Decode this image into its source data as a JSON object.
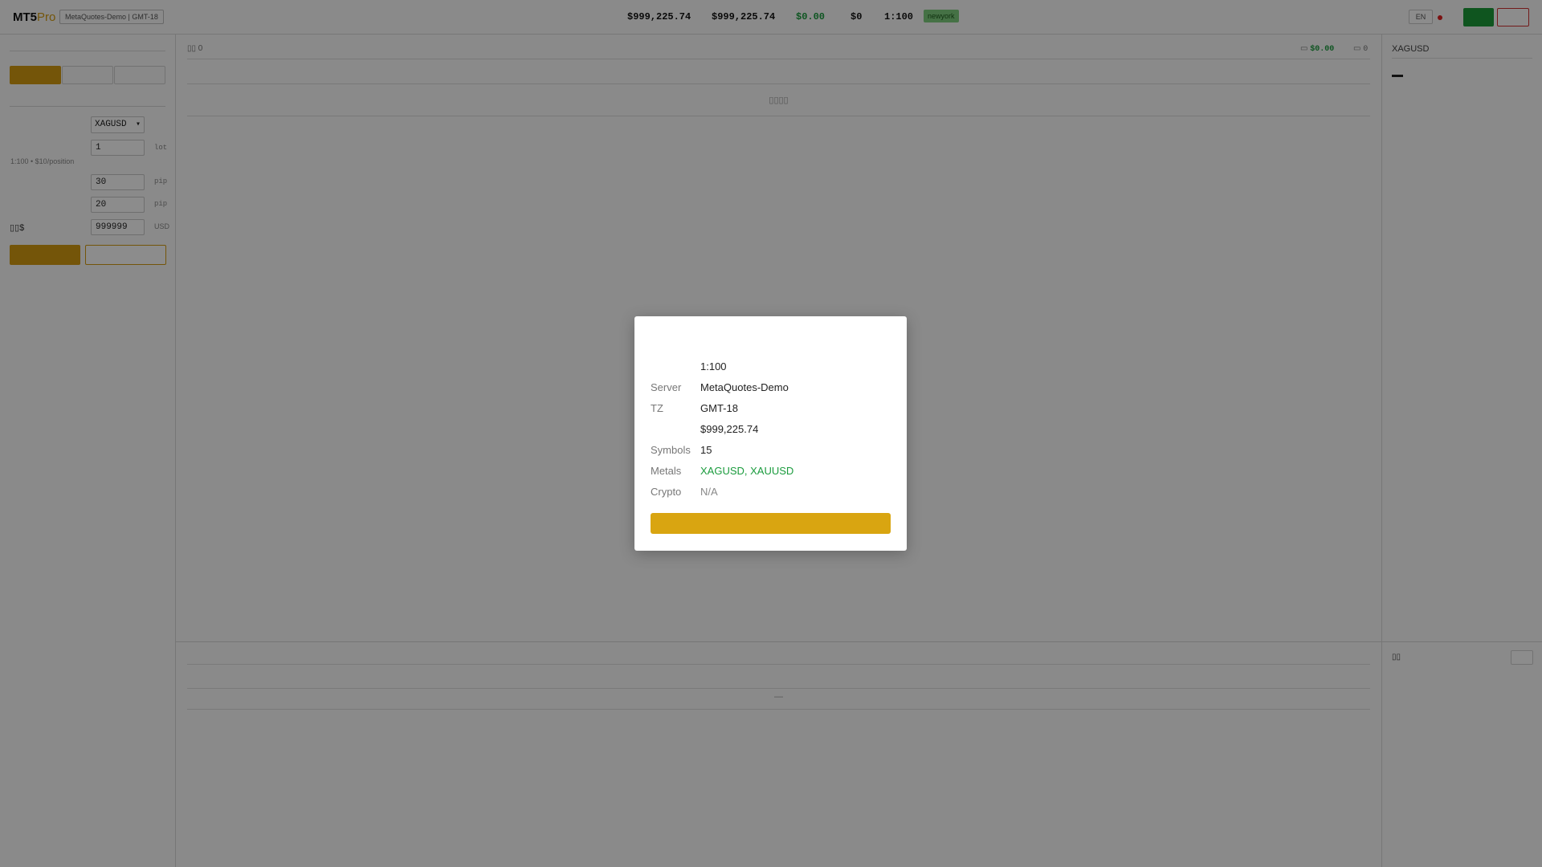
{
  "topbar": {
    "logo_main": "MT5",
    "logo_accent": "Pro",
    "server_badge": "MetaQuotes-Demo | GMT-18",
    "balance": "$999,225.74",
    "equity": "$999,225.74",
    "profit": "$0.00",
    "margin": "$0",
    "leverage": "1:100",
    "session": "newyork",
    "language": "EN",
    "colors": {
      "accent": "#d39c12",
      "buy": "#1c9b3a",
      "sell": "#d03030",
      "profit": "#1a9b3d"
    }
  },
  "order_form": {
    "symbol": "XAGUSD",
    "volume": "1",
    "volume_unit": "lot",
    "hint": "1:100 • $10/position",
    "take_profit": "30",
    "tp_unit": "pip",
    "stop_loss": "20",
    "sl_unit": "pip",
    "balance_label": "▯▯$",
    "balance_value": "999999",
    "balance_unit": "USD"
  },
  "positions": {
    "count_label": "▯▯ 0",
    "pnl_icon": "▭",
    "pnl_value": "$0.00",
    "count_icon": "▭",
    "open_count": "0",
    "empty_text": "▯▯▯▯"
  },
  "history": {
    "empty_text": "—"
  },
  "watch": {
    "symbol": "XAGUSD"
  },
  "right_bottom": {
    "title": "▯▯"
  },
  "account_modal": {
    "rows": [
      {
        "key": "",
        "value": "1:100",
        "style": "normal"
      },
      {
        "key": "Server",
        "value": "MetaQuotes-Demo",
        "style": "normal"
      },
      {
        "key": "TZ",
        "value": "GMT-18",
        "style": "normal"
      },
      {
        "key": "",
        "value": "$999,225.74",
        "style": "normal"
      },
      {
        "key": "Symbols",
        "value": "15",
        "style": "normal"
      },
      {
        "key": "Metals",
        "value": "XAGUSD, XAUUSD",
        "style": "green"
      },
      {
        "key": "Crypto",
        "value": "N/A",
        "style": "gray"
      }
    ]
  }
}
